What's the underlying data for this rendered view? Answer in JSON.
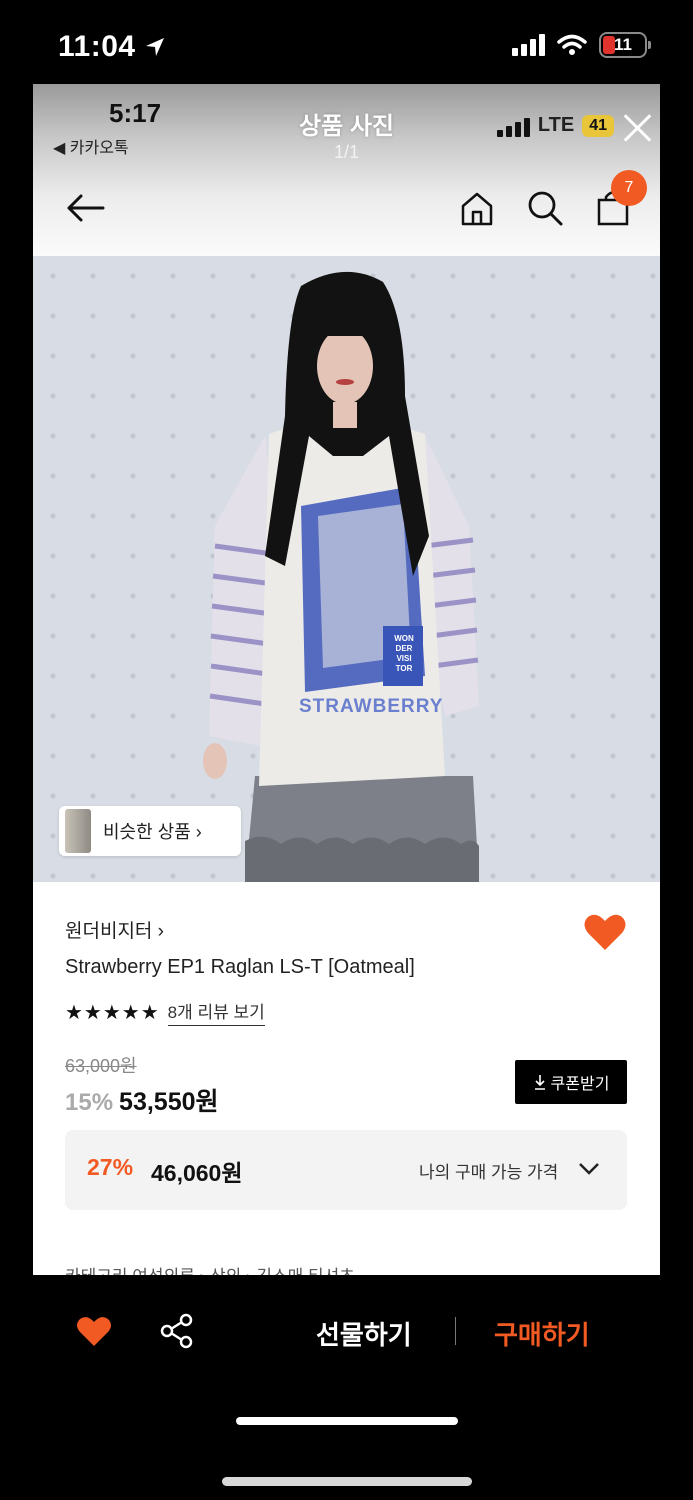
{
  "outer_status": {
    "time": "11:04",
    "battery": "11"
  },
  "inner": {
    "time": "5:17",
    "back_app": "◀ 카카오톡",
    "network": "LTE",
    "battery": "41",
    "photo_title": "상품 사진",
    "photo_count": "1/1",
    "cart_count": "7"
  },
  "photo": {
    "shirt_text": "STRAWBERRY",
    "tag_lines": [
      "WON",
      "DER",
      "VISI",
      "TOR"
    ],
    "similar_label": "비슷한 상품 ›"
  },
  "product": {
    "brand": "원더비지터 ›",
    "name": "Strawberry EP1 Raglan LS-T [Oatmeal]",
    "stars": "★★★★★",
    "reviews": "8개 리뷰 보기",
    "original_price": "63,000원",
    "discount_pct": "15%",
    "price": "53,550원",
    "coupon": "쿠폰받기",
    "my_pct": "27%",
    "my_price": "46,060원",
    "my_label": "나의 구매 가능 가격",
    "category": "카테고리   여성의류 › 상의 › 긴소매 티셔츠"
  },
  "bottom": {
    "gift": "선물하기",
    "buy": "구매하기"
  },
  "colors": {
    "accent": "#f15a22"
  }
}
